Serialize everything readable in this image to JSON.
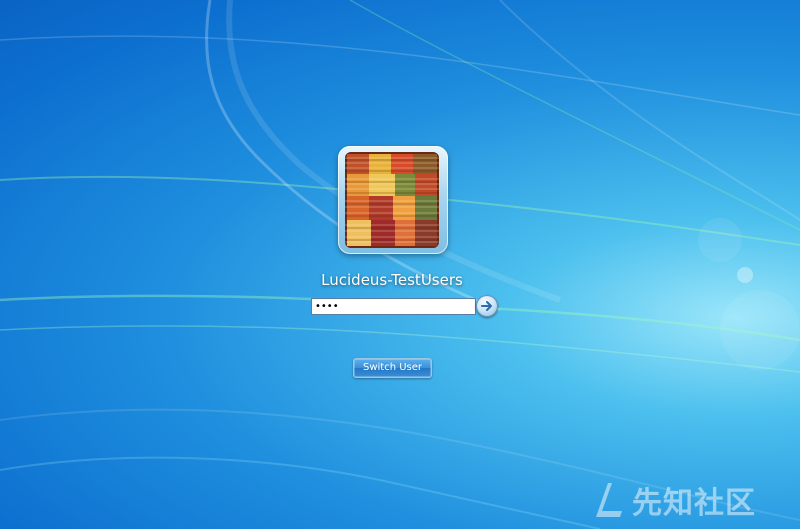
{
  "login": {
    "username": "Lucideus-TestUsers",
    "password_value": "••••",
    "switch_user_label": "Switch User"
  },
  "icons": {
    "avatar": "user-tile-woven-textile-picture",
    "submit": "arrow-right-icon"
  },
  "watermark": {
    "text": "先知社区",
    "logo": "xianzhi-logo"
  },
  "colors": {
    "background_dark": "#0a63c4",
    "background_mid": "#1f8fde",
    "background_light": "#9be6fa",
    "button_blue": "#3a90d8",
    "text_white": "#ffffff"
  }
}
